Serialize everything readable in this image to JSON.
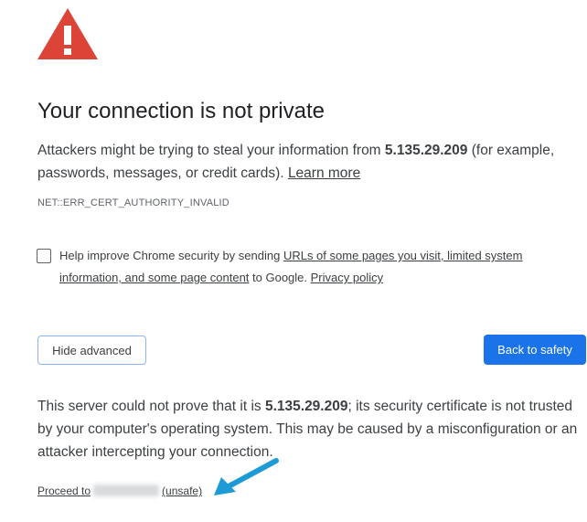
{
  "icons": {
    "warning": "warning-triangle-icon",
    "checkbox": "checkbox-icon",
    "arrow": "annotation-arrow-icon"
  },
  "colors": {
    "warning_red": "#db4437",
    "primary_blue": "#1a73e8",
    "arrow_blue": "#1e9bd7"
  },
  "heading": "Your connection is not private",
  "description": {
    "prefix": "Attackers might be trying to steal your information from ",
    "host": "5.135.29.209",
    "suffix": " (for example, passwords, messages, or credit cards). ",
    "learn_more": "Learn more"
  },
  "error_code": "NET::ERR_CERT_AUTHORITY_INVALID",
  "opt_in": {
    "checked": false,
    "prefix": "Help improve Chrome security by sending ",
    "link_urls": "URLs of some pages you visit, limited system information, and some page content",
    "middle": " to Google. ",
    "privacy_link": "Privacy policy"
  },
  "buttons": {
    "hide_advanced": "Hide advanced",
    "back_to_safety": "Back to safety"
  },
  "details": {
    "prefix": "This server could not prove that it is ",
    "host": "5.135.29.209",
    "suffix": "; its security certificate is not trusted by your computer's operating system. This may be caused by a misconfiguration or an attacker intercepting your connection."
  },
  "proceed": {
    "prefix": "Proceed to",
    "suffix": "(unsafe)"
  }
}
